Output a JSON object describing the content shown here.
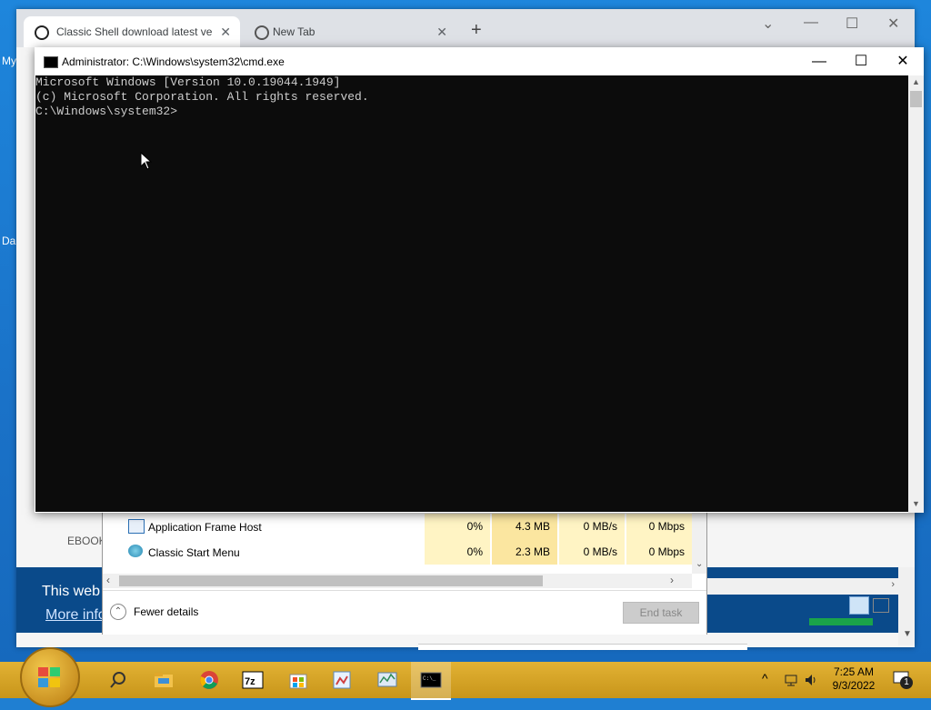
{
  "desktop": {
    "label_top": "My",
    "label_bottom": "Da"
  },
  "browser": {
    "tabs": [
      {
        "title": "Classic Shell download latest ver"
      },
      {
        "title": "New Tab"
      }
    ],
    "new_tab": "+",
    "page": {
      "ebook_label": "EBOOK",
      "banner_line1": "This web",
      "banner_line2": "More info"
    }
  },
  "task_manager": {
    "rows": [
      {
        "name": "Application Frame Host",
        "cpu": "0%",
        "memory": "4.3 MB",
        "disk": "0 MB/s",
        "network": "0 Mbps"
      },
      {
        "name": "Classic Start Menu",
        "cpu": "0%",
        "memory": "2.3 MB",
        "disk": "0 MB/s",
        "network": "0 Mbps"
      }
    ],
    "fewer_details": "Fewer details",
    "end_task": "End task"
  },
  "cmd": {
    "title": "Administrator: C:\\Windows\\system32\\cmd.exe",
    "lines": [
      "Microsoft Windows [Version 10.0.19044.1949]",
      "(c) Microsoft Corporation. All rights reserved.",
      "",
      "C:\\Windows\\system32>"
    ]
  },
  "taskbar": {
    "icons": [
      "search-icon",
      "file-explorer-icon",
      "chrome-icon",
      "7zip-icon",
      "store-icon",
      "paint-icon",
      "resource-monitor-icon",
      "cmd-icon"
    ],
    "time": "7:25 AM",
    "date": "9/3/2022",
    "notification_count": "1"
  },
  "colors": {
    "console_bg": "#0c0c0c",
    "console_fg": "#cccccc",
    "taskbar": "#d6a21a",
    "desktop": "#1e86dc"
  }
}
